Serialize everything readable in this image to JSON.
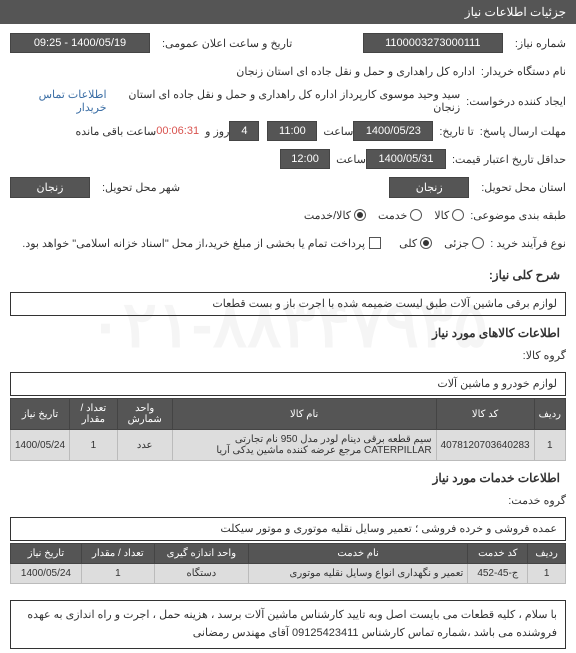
{
  "header": {
    "title": "جزئیات اطلاعات نیاز"
  },
  "form": {
    "need_no_label": "شماره نیاز:",
    "need_no": "1100003273000111",
    "public_time_label": "تاریخ و ساعت اعلان عمومی:",
    "public_time": "1400/05/19 - 09:25",
    "buyer_label": "نام دستگاه خریدار:",
    "buyer": "اداره کل راهداری و حمل و نقل جاده ای استان زنجان",
    "creator_label": "ایجاد کننده درخواست:",
    "creator": "سید وحید موسوی کارپرداز اداره کل راهداری و حمل و نقل جاده ای استان زنجان",
    "buyer_contact_link": "اطلاعات تماس خریدار",
    "deadline_label": "مهلت ارسال پاسخ:",
    "deadline_date": "1400/05/23",
    "time_word": "ساعت",
    "deadline_time": "11:00",
    "day_word": "روز و",
    "days": "4",
    "hour_word": "ساعت",
    "timer": "00:06:31",
    "remain": "ساعت باقی مانده",
    "ta_tarikh": "تا تاریخ:",
    "credit_exp_label": "حداقل تاریخ اعتبار قیمت:",
    "credit_exp_date": "1400/05/31",
    "credit_exp_time": "12:00",
    "province_label": "استان محل تحویل:",
    "province": "زنجان",
    "city_label": "شهر محل تحویل:",
    "city": "زنجان",
    "category_label": "طبقه بندی موضوعی:",
    "cat_goods": "کالا",
    "cat_service": "خدمت",
    "cat_both": "کالا/خدمت",
    "buy_type_label": "نوع فرآیند خرید :",
    "buy_partial": "جزئی",
    "buy_full": "کلی",
    "pay_note": "پرداخت تمام یا بخشی از مبلغ خرید،از محل \"اسناد خزانه اسلامی\" خواهد بود.",
    "desc_label": "شرح کلی نیاز:",
    "desc_value": "لوازم برقی ماشین آلات طبق لیست ضمیمه شده با اجرت باز و بست قطعات"
  },
  "goods": {
    "section": "اطلاعات کالاهای مورد نیاز",
    "group_label": "گروه کالا:",
    "group_value": "لوازم خودرو و ماشین آلات",
    "cols": {
      "row": "ردیف",
      "code": "کد کالا",
      "name": "نام کالا",
      "unit": "واحد شمارش",
      "qty": "تعداد / مقدار",
      "date": "تاریخ نیاز"
    },
    "rows": [
      {
        "row": "1",
        "code": "4078120703640283",
        "name": "سیم قطعه برقی دینام لودر مدل 950 نام تجارتی CATERPILLAR مرجع عرضه کننده ماشین یدکی آریا",
        "unit": "عدد",
        "qty": "1",
        "date": "1400/05/24"
      }
    ]
  },
  "services": {
    "section": "اطلاعات خدمات مورد نیاز",
    "group_label": "گروه خدمت:",
    "group_value": "عمده فروشی و خرده فروشی ؛ تعمیر وسایل نقلیه موتوری و موتور سیکلت",
    "cols": {
      "row": "ردیف",
      "code": "کد خدمت",
      "name": "نام خدمت",
      "unit": "واحد اندازه گیری",
      "qty": "تعداد / مقدار",
      "date": "تاریخ نیاز"
    },
    "rows": [
      {
        "row": "1",
        "code": "ج-45-452",
        "name": "تعمیر و نگهداری انواع وسایل نقلیه موتوری",
        "unit": "دستگاه",
        "qty": "1",
        "date": "1400/05/24"
      }
    ]
  },
  "note": "با سلام ، کلیه قطعات می بایست اصل وبه تایید کارشناس ماشین آلات برسد ، هزینه حمل ، اجرت و راه اندازی به عهده فروشنده می باشد ،شماره تماس کارشناس 09125423411 آقای مهندس رمضانی",
  "watermark": "۰۲۱-۸۸۳۴۷۹۳۵"
}
